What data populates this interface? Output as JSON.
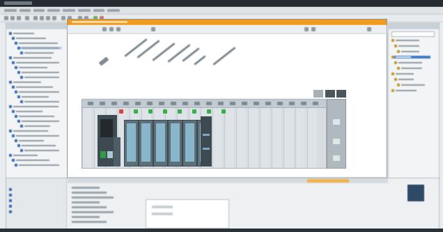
{
  "window": {
    "title": "",
    "menu_items": [
      "",
      "",
      "",
      "",
      "",
      "",
      "",
      ""
    ]
  },
  "colors": {
    "accent_tab": "#f29a1b",
    "selection": "#3f7cc4",
    "status_green": "#38b04a",
    "status_red": "#e2413a",
    "module_face": "#8ab6cc"
  },
  "icons": {
    "toolbar": [
      "new-project-icon",
      "open-icon",
      "save-icon",
      "print-icon",
      "cut-icon",
      "copy-icon",
      "paste-icon",
      "delete-icon",
      "undo-icon",
      "redo-icon",
      "compile-icon",
      "download-icon",
      "go-online-icon",
      "go-offline-icon"
    ]
  },
  "project_tree": {
    "rows": 28,
    "selected_index": 3
  },
  "catalog": {
    "search_placeholder": "",
    "rows": 10,
    "selected_index": 3
  },
  "device_editor": {
    "tab_label": "",
    "rack_slots": 20,
    "io_modules": 6,
    "indicators": [
      "red",
      "green",
      "green",
      "green",
      "green",
      "green",
      "green",
      "green"
    ]
  },
  "inspector": {
    "tabs": [
      "",
      "",
      ""
    ]
  }
}
